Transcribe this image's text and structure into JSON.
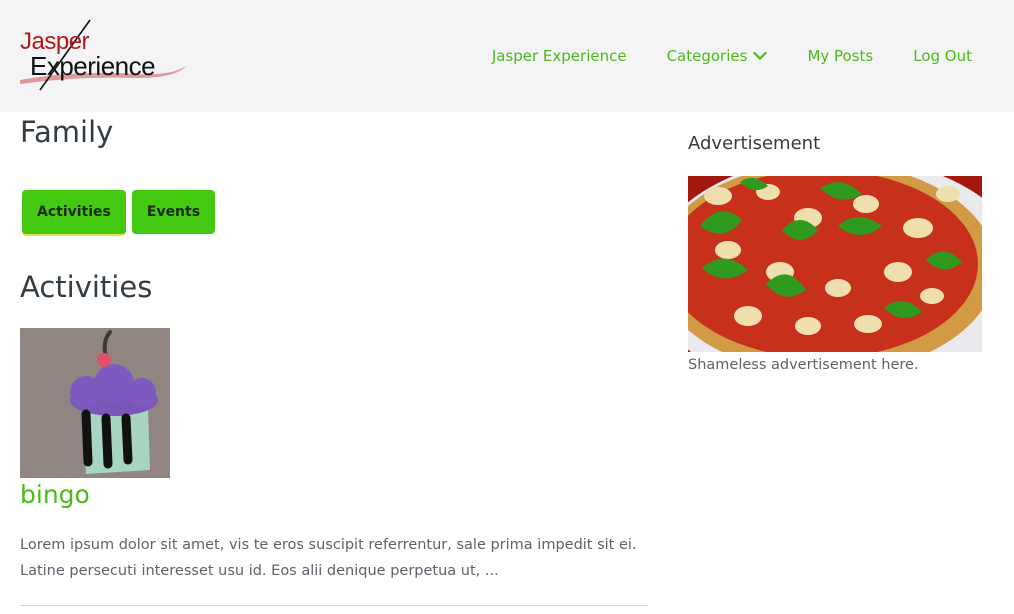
{
  "header": {
    "logo": {
      "line1": "Jasper",
      "line2": "Experience"
    },
    "nav": [
      {
        "label": "Jasper Experience"
      },
      {
        "label": "Categories"
      },
      {
        "label": "My Posts"
      },
      {
        "label": "Log Out"
      }
    ]
  },
  "main": {
    "title": "Family",
    "buttons": [
      {
        "label": "Activities"
      },
      {
        "label": "Events"
      }
    ],
    "section_title": "Activities",
    "post": {
      "title": "bingo",
      "excerpt": "Lorem ipsum dolor sit amet, vis te eros suscipit referrentur, sale prima impedit sit ei. Latine persecuti interesset usu id. Eos alii denique perpetua ut, ..."
    }
  },
  "sidebar": {
    "ad_title": "Advertisement",
    "ad_caption": "Shameless advertisement here."
  },
  "colors": {
    "accent": "#4cbb17",
    "button": "#44c911",
    "header_bg": "#f4f4f6",
    "logo_red": "#b01a1a"
  }
}
